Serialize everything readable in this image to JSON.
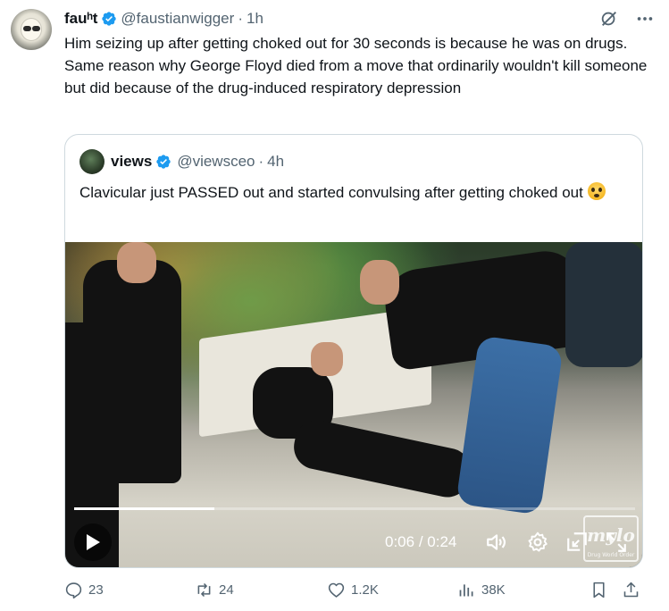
{
  "tweet": {
    "author_name": "fauʰt",
    "author_handle": "@faustianwigger",
    "separator": "·",
    "time": "1h",
    "text": "Him seizing up after getting choked out for 30 seconds is because he was on drugs. Same reason why George Floyd died from a move that ordinarily wouldn't kill someone but did because of the drug-induced respiratory depression"
  },
  "quoted": {
    "author_name": "views",
    "author_handle": "@viewsceo",
    "separator": "·",
    "time": "4h",
    "text": "Clavicular just PASSED out and started convulsing after getting choked out",
    "emoji": "flushed-face"
  },
  "video": {
    "current_time": "0:06",
    "duration": "0:24",
    "time_divider": " / ",
    "progress": 0.25,
    "watermark_text": "mylo",
    "watermark_subtext": "Drug World Order"
  },
  "actions": {
    "replies": "23",
    "reposts": "24",
    "likes": "1.2K",
    "views": "38K"
  },
  "colors": {
    "text": "#0f1419",
    "secondary": "#536471",
    "verified": "#1d9bf0",
    "border": "#cfd9de"
  },
  "icons": [
    "verified-badge-icon",
    "grok-icon",
    "more-icon",
    "play-icon",
    "volume-icon",
    "settings-gear-icon",
    "minimize-icon",
    "fullscreen-icon",
    "reply-icon",
    "repost-icon",
    "like-icon",
    "views-icon",
    "bookmark-icon",
    "share-icon"
  ]
}
